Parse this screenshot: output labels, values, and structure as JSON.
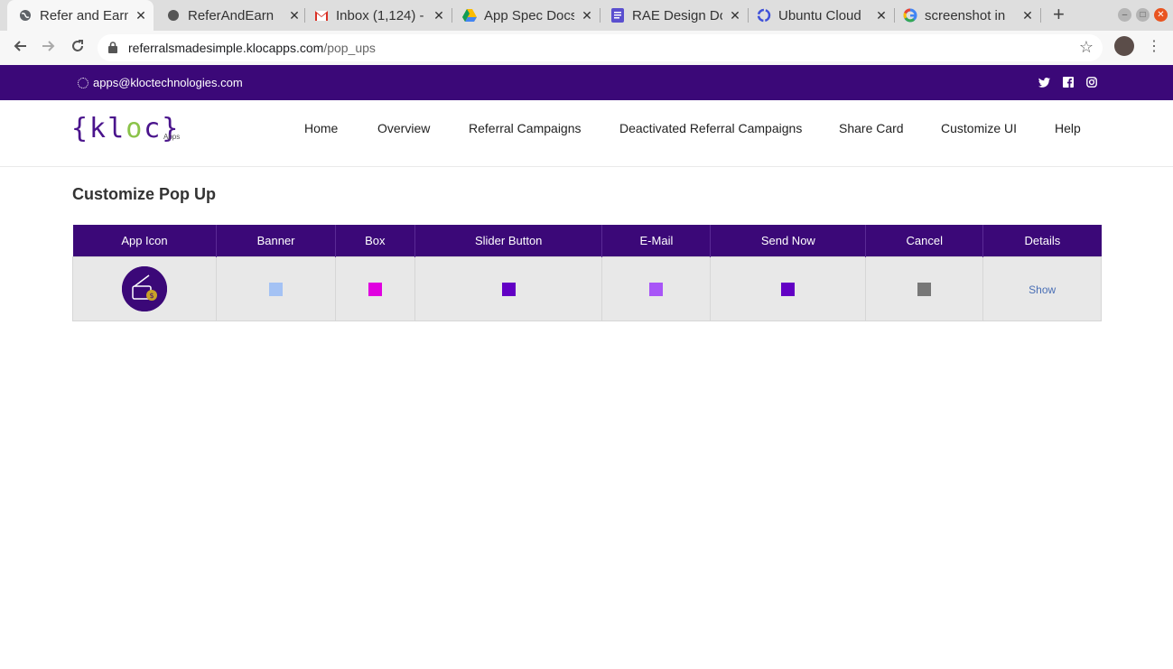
{
  "browser": {
    "tabs": [
      {
        "title": "Refer and Earn",
        "icon": "globe-icon",
        "active": true
      },
      {
        "title": "ReferAndEarn",
        "icon": "github-icon"
      },
      {
        "title": "Inbox (1,124) -",
        "icon": "gmail-icon"
      },
      {
        "title": "App Spec Docs",
        "icon": "drive-icon"
      },
      {
        "title": "RAE Design Do",
        "icon": "docs-icon"
      },
      {
        "title": "Ubuntu Cloud",
        "icon": "ubuntu-icon"
      },
      {
        "title": "screenshot in",
        "icon": "google-icon"
      }
    ],
    "url_host": "referralsmadesimple.klocapps.com",
    "url_path": "/pop_ups"
  },
  "site": {
    "contact_email": "apps@kloctechnologies.com",
    "social": [
      "twitter-icon",
      "facebook-icon",
      "instagram-icon"
    ],
    "logo_text": "{kloc}",
    "logo_sub": "Apps",
    "nav": [
      "Home",
      "Overview",
      "Referral Campaigns",
      "Deactivated Referral Campaigns",
      "Share Card",
      "Customize UI",
      "Help"
    ]
  },
  "page": {
    "title": "Customize Pop Up",
    "table": {
      "headers": [
        "App Icon",
        "Banner",
        "Box",
        "Slider Button",
        "E-Mail",
        "Send Now",
        "Cancel",
        "Details"
      ],
      "row": {
        "banner_color": "#a4c2f4",
        "box_color": "#e000e0",
        "slider_button_color": "#6200c4",
        "email_color": "#a855f7",
        "send_now_color": "#6200c4",
        "cancel_color": "#777777",
        "details_link": "Show"
      }
    }
  },
  "colors": {
    "brand_purple": "#3b0878",
    "logo_green": "#8bc34a"
  }
}
